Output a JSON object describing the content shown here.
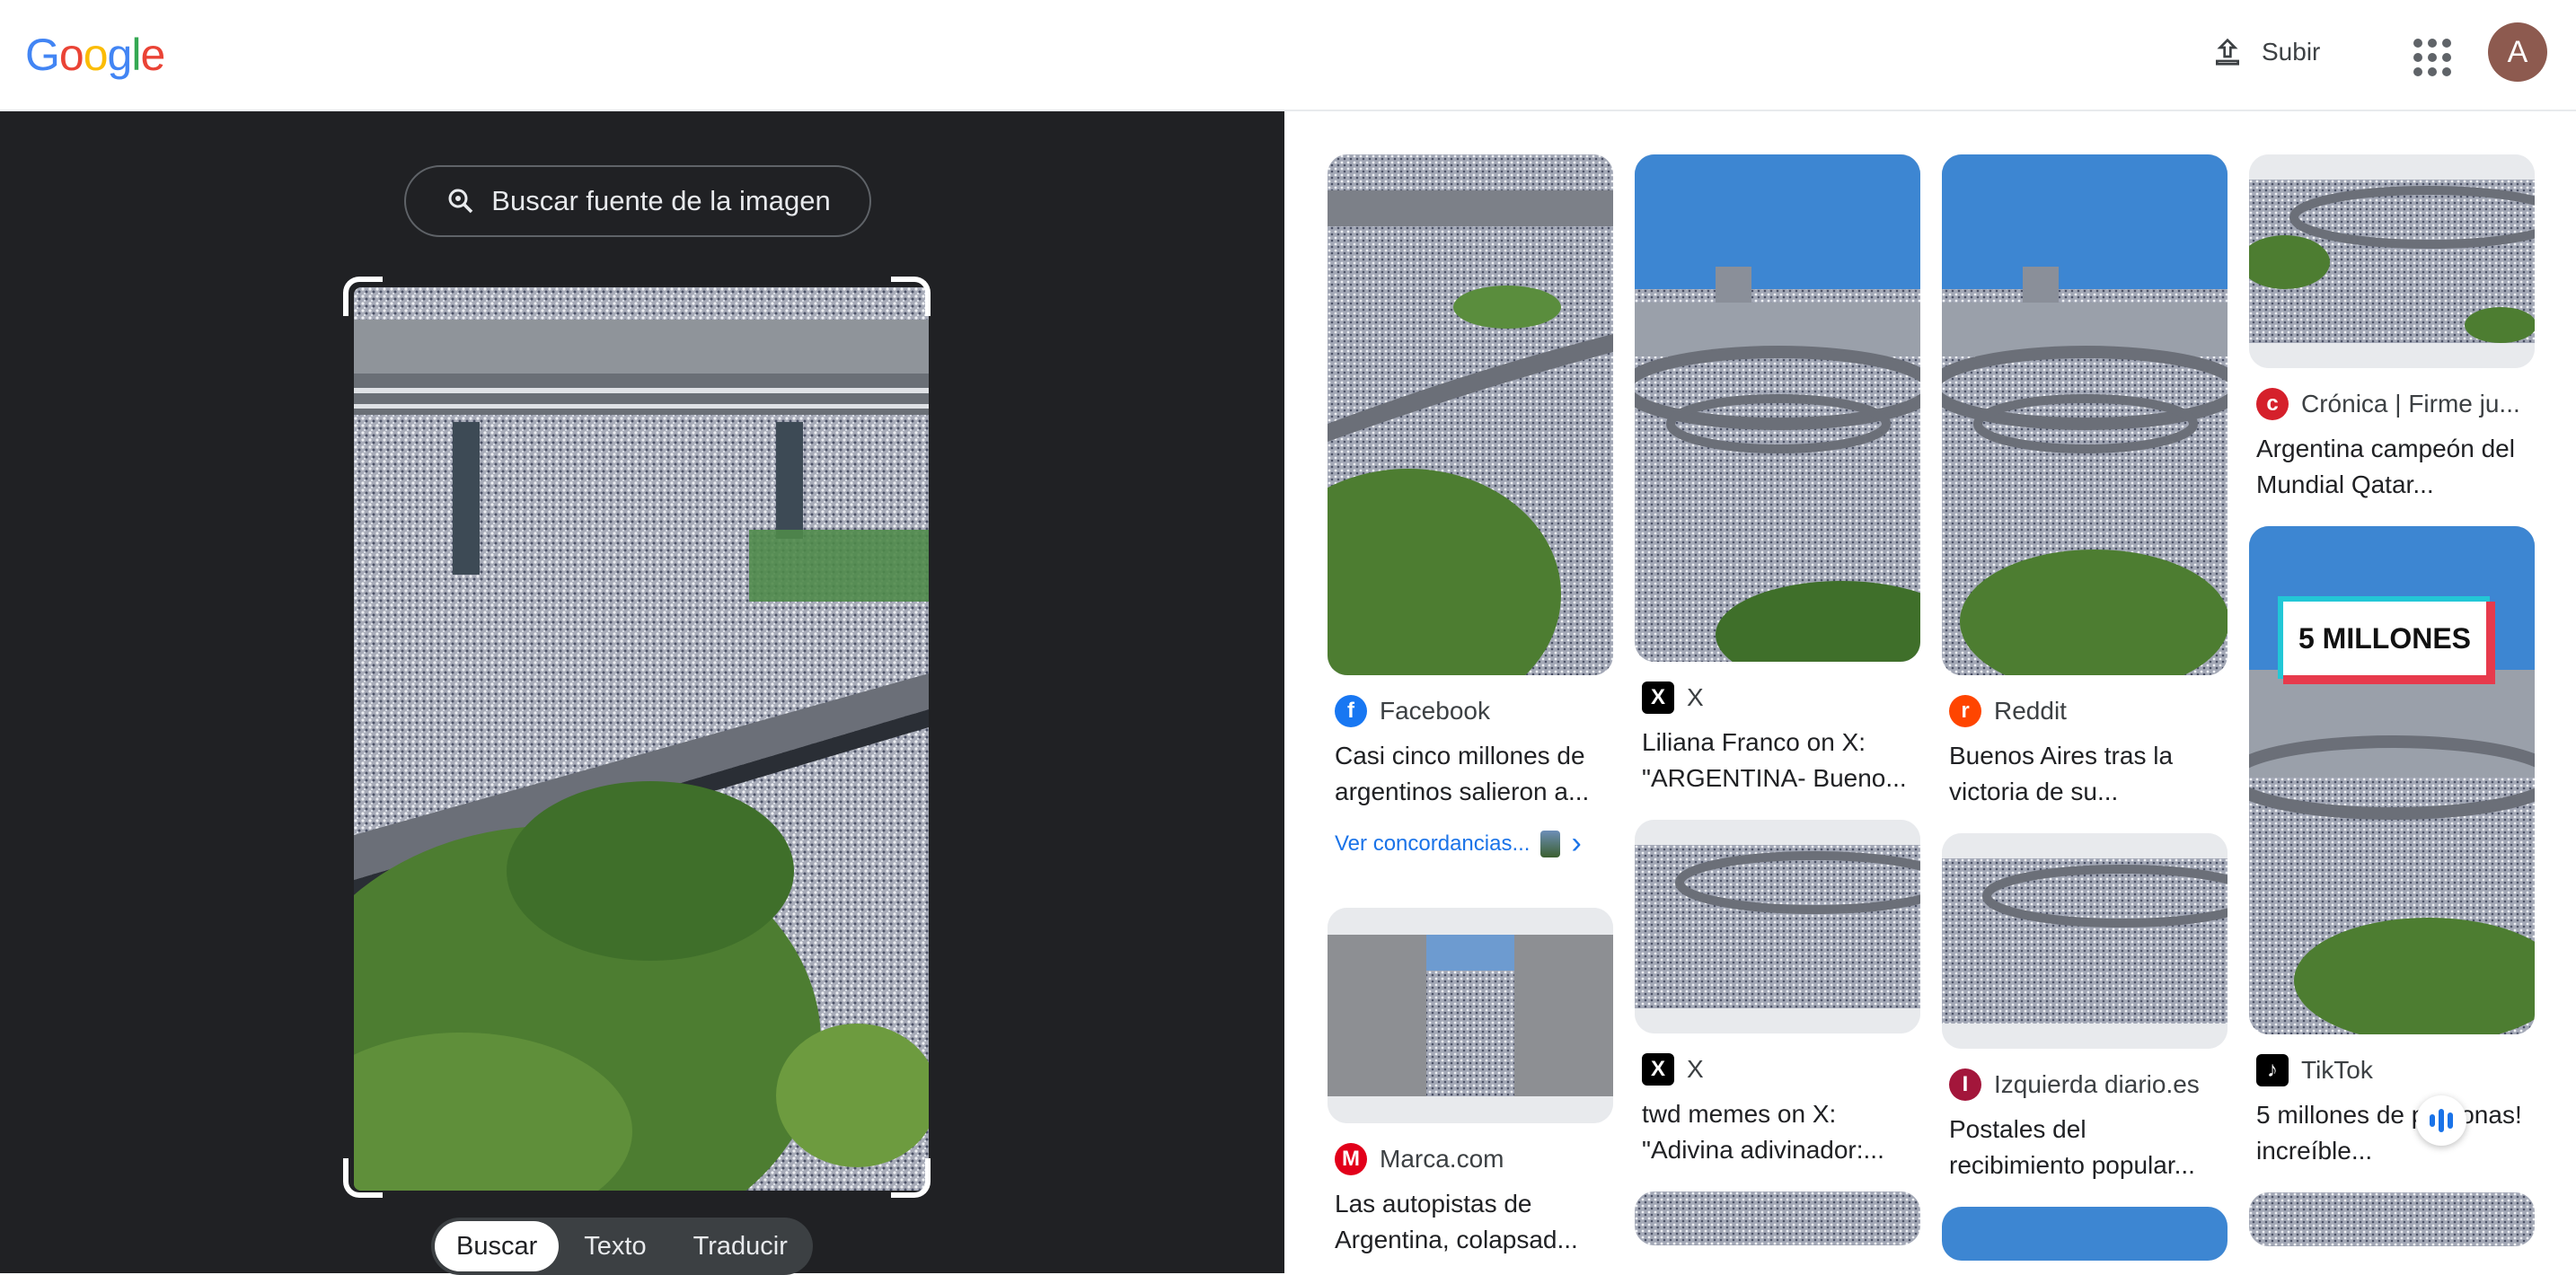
{
  "header": {
    "logo_letters": [
      {
        "ch": "G",
        "color": "#4285F4"
      },
      {
        "ch": "o",
        "color": "#EA4335"
      },
      {
        "ch": "o",
        "color": "#FBBC05"
      },
      {
        "ch": "g",
        "color": "#4285F4"
      },
      {
        "ch": "l",
        "color": "#34A853"
      },
      {
        "ch": "e",
        "color": "#EA4335"
      }
    ],
    "upload_label": "Subir",
    "avatar_letter": "A"
  },
  "left_panel": {
    "find_source_label": "Buscar fuente de la imagen",
    "tabs": [
      {
        "label": "Buscar",
        "active": true
      },
      {
        "label": "Texto",
        "active": false
      },
      {
        "label": "Traducir",
        "active": false
      }
    ]
  },
  "results": {
    "columns": [
      [
        {
          "thumb_h": 580,
          "style": "crowd-trees",
          "source": "Facebook",
          "source_icon": "facebook-icon",
          "icon_color": "#1877F2",
          "icon_text": "f",
          "title": "Casi cinco millones de argentinos salieron a...",
          "match_label": "Ver concordancias..."
        },
        {
          "thumb_h": 240,
          "style": "pillarbox",
          "source": "Marca.com",
          "source_icon": "marca-icon",
          "icon_color": "#e2001a",
          "icon_text": "M",
          "title": "Las autopistas de Argentina, colapsad..."
        }
      ],
      [
        {
          "thumb_h": 565,
          "style": "sky-crowd",
          "source": "X",
          "source_icon": "x-icon",
          "icon_color": "#000000",
          "icon_text": "X",
          "title": "Liliana Franco on X: \"ARGENTINA- Bueno..."
        },
        {
          "thumb_h": 238,
          "style": "wide-crowd",
          "source": "X",
          "source_icon": "x-icon",
          "icon_color": "#000000",
          "icon_text": "X",
          "title": "twd memes on X: \"Adivina adivinador:..."
        },
        {
          "thumb_h": 60,
          "style": "crowd"
        }
      ],
      [
        {
          "thumb_h": 580,
          "style": "sky-crowd-trees",
          "source": "Reddit",
          "source_icon": "reddit-icon",
          "icon_color": "#FF4500",
          "icon_text": "r",
          "title": "Buenos Aires tras la victoria de su..."
        },
        {
          "thumb_h": 240,
          "style": "wide-crowd",
          "source": "Izquierda diario.es",
          "source_icon": "izquierda-diario-icon",
          "icon_color": "#a3163b",
          "icon_text": "I",
          "title": "Postales del recibimiento popular..."
        },
        {
          "thumb_h": 60,
          "style": "sky"
        }
      ],
      [
        {
          "thumb_h": 238,
          "style": "wide-crowd-trees",
          "source": "Crónica | Firme ju...",
          "source_icon": "cronica-icon",
          "icon_color": "#d5202b",
          "icon_text": "c",
          "title": "Argentina campeón del Mundial Qatar..."
        },
        {
          "thumb_h": 566,
          "style": "tiktok",
          "badge": "5 MILLONES",
          "source": "TikTok",
          "source_icon": "tiktok-icon",
          "icon_color": "#000000",
          "icon_text": "♪",
          "title": "5 millones de personas! increíble..."
        },
        {
          "thumb_h": 60,
          "style": "crowd"
        }
      ]
    ]
  }
}
